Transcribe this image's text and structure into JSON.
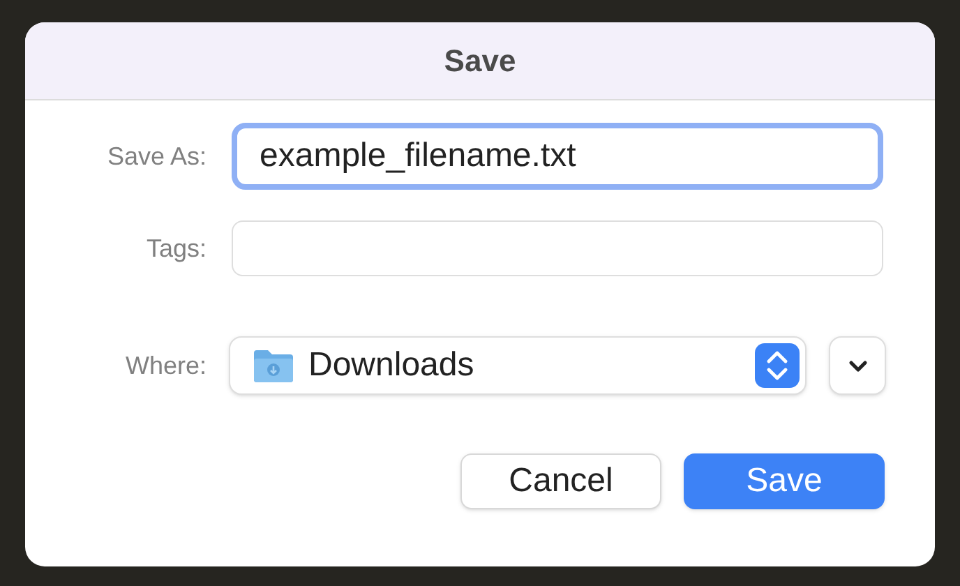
{
  "window": {
    "title": "Save"
  },
  "save_as": {
    "label": "Save As:",
    "value": "example_filename.txt",
    "focused": true
  },
  "tags": {
    "label": "Tags:"
  },
  "where": {
    "label": "Where:",
    "value": "Downloads"
  },
  "buttons": [
    {
      "label": "Cancel",
      "kind": "normal"
    },
    {
      "label": "Save",
      "kind": "default"
    }
  ]
}
